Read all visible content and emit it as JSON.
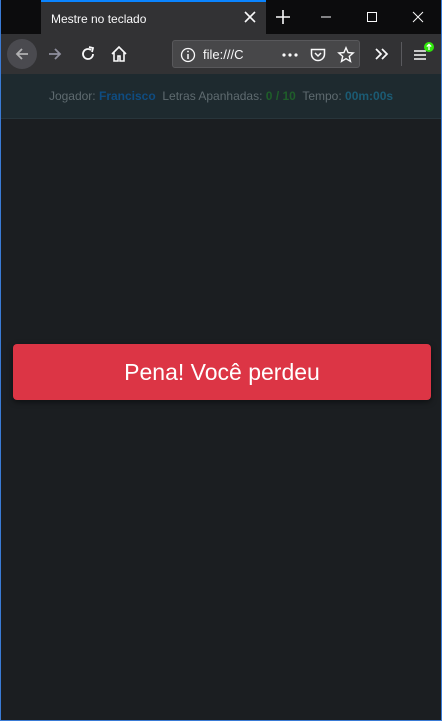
{
  "browser": {
    "tab_title": "Mestre no teclado",
    "url": "file:///C",
    "colors": {
      "accent": "#0a84ff",
      "toolbar": "#323234",
      "titlebar": "#0c0c0d"
    }
  },
  "game": {
    "player_label": "Jogador:",
    "player_name": "Francisco",
    "letters_label": "Letras Apanhadas:",
    "letters_caught": "0",
    "letters_separator": "/",
    "letters_total": "10",
    "time_label": "Tempo:",
    "time_value": "00m:00s",
    "result_message": "Pena! Você perdeu",
    "colors": {
      "background": "#1b1e21",
      "danger": "#dc3545"
    }
  },
  "icons": {
    "tab_close": "close-icon",
    "new_tab": "plus-icon",
    "minimize": "minimize-icon",
    "maximize": "maximize-icon",
    "close_window": "close-icon",
    "back": "arrow-left-icon",
    "forward": "arrow-right-icon",
    "reload": "reload-icon",
    "home": "home-icon",
    "site_info": "info-icon",
    "page_actions": "more-icon",
    "pocket": "pocket-icon",
    "bookmark": "star-icon",
    "overflow": "chevrons-right-icon",
    "menu": "hamburger-menu-icon"
  }
}
